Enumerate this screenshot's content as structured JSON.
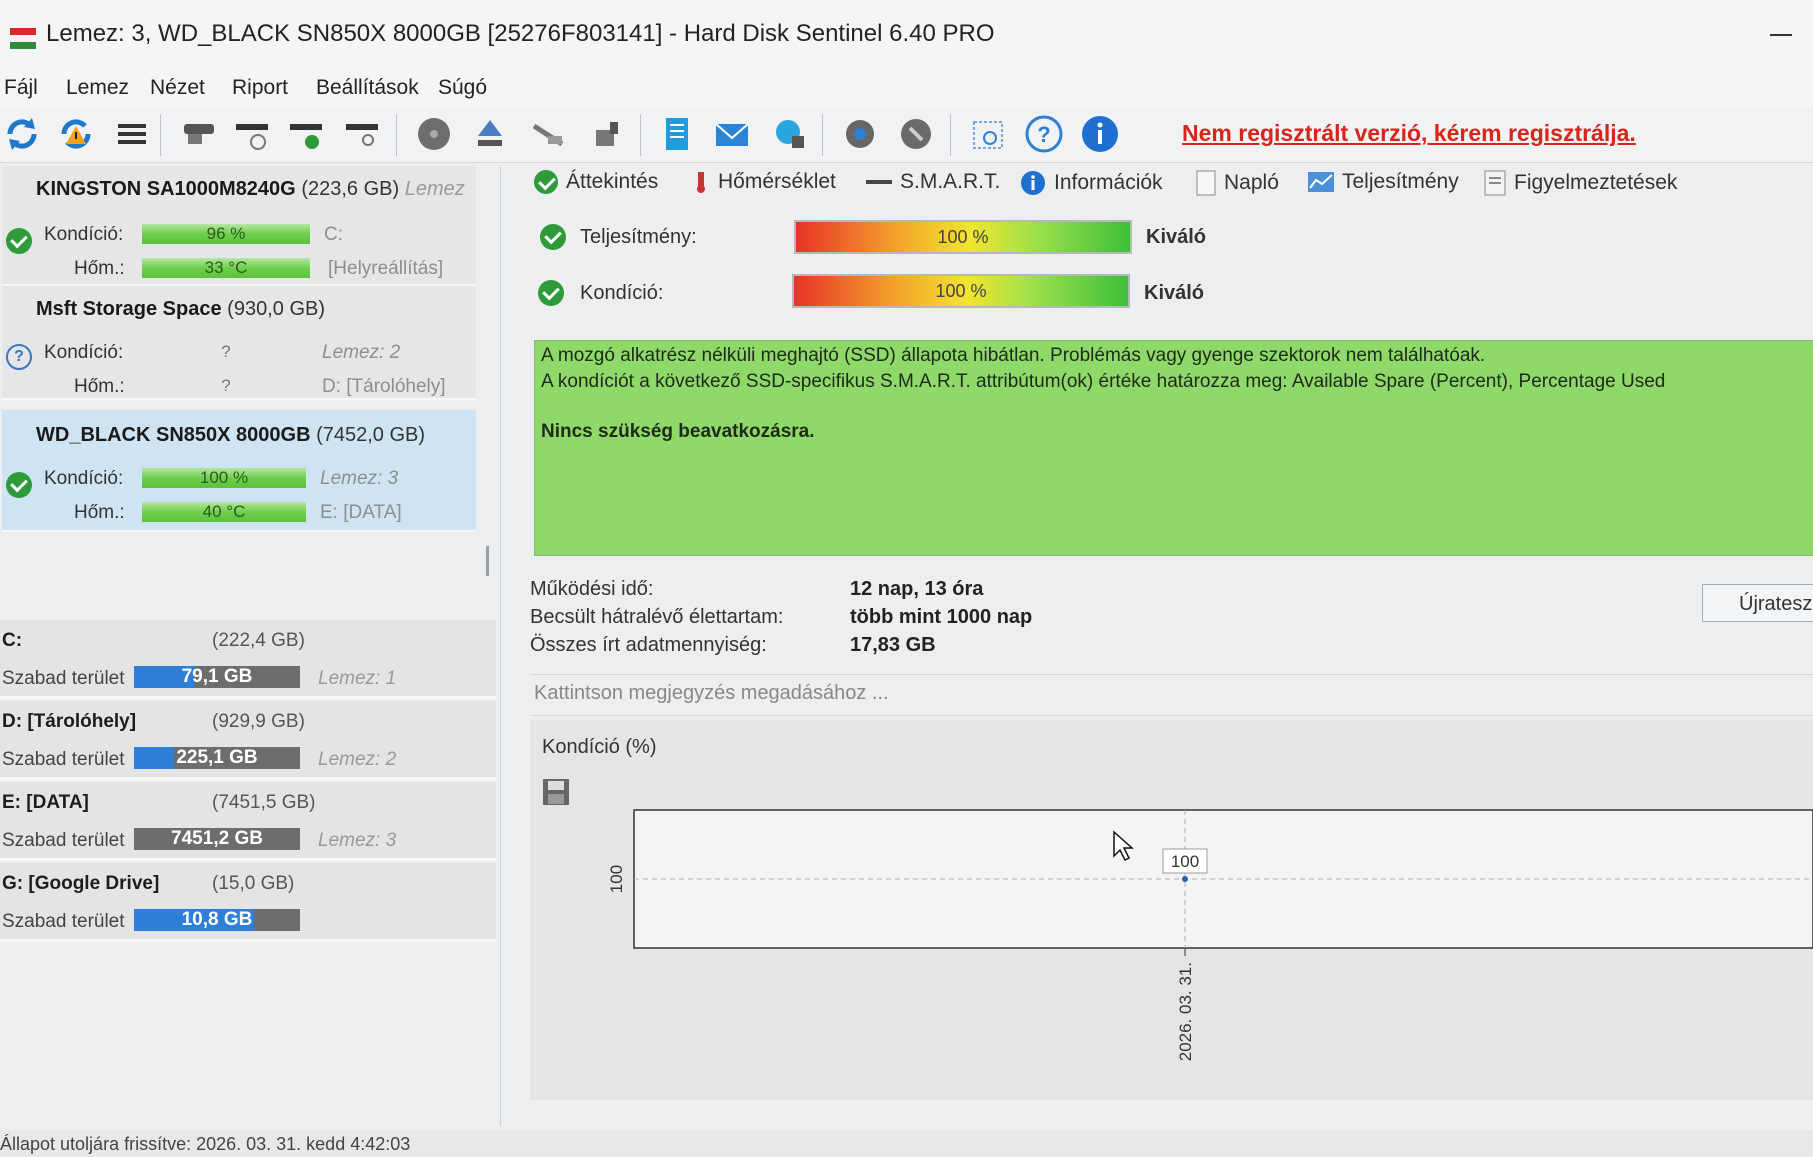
{
  "window": {
    "title": "Lemez: 3, WD_BLACK SN850X 8000GB [25276F803141]  -  Hard Disk Sentinel 6.40 PRO"
  },
  "menu": [
    "Fájl",
    "Lemez",
    "Nézet",
    "Riport",
    "Beállítások",
    "Súgó"
  ],
  "toolbar": {
    "icons": [
      "refresh-icon",
      "refresh-warning-icon",
      "disk-list-icon",
      "disk-icon",
      "disk-schedule-icon",
      "disk-check-icon",
      "disk-search-icon",
      "drive-icon",
      "eject-icon",
      "tools-icon",
      "gear-tools-icon",
      "report-icon",
      "email-icon",
      "network-icon",
      "settings-icon",
      "shield-icon",
      "screenshot-icon",
      "help-icon",
      "info-icon"
    ],
    "register_text": "Nem regisztrált verzió, kérem regisztrálja."
  },
  "disks": [
    {
      "name": "KINGSTON SA1000M8240G",
      "size": "(223,6 GB)",
      "lemez": "Lemez",
      "condition_label": "Kondíció:",
      "condition": "96 %",
      "condition_level": 0.96,
      "temp_label": "Hőm.:",
      "temp": "33 °C",
      "right1": "C:",
      "right2": "[Helyreállítás]",
      "status": "ok"
    },
    {
      "name": "Msft    Storage Space",
      "size": "(930,0 GB)",
      "lemez": "",
      "condition_label": "Kondíció:",
      "condition": "?",
      "temp_label": "Hőm.:",
      "temp": "?",
      "right1": "Lemez: 2",
      "right2": "D: [Tárolóhely]",
      "status": "unknown"
    },
    {
      "name": "WD_BLACK SN850X 8000GB",
      "size": "(7452,0 GB)",
      "lemez": "",
      "condition_label": "Kondíció:",
      "condition": "100 %",
      "condition_level": 1.0,
      "temp_label": "Hőm.:",
      "temp": "40 °C",
      "right1": "Lemez: 3",
      "right2": "E: [DATA]",
      "status": "ok"
    }
  ],
  "volumes": [
    {
      "name": "C:",
      "size": "(222,4 GB)",
      "free_label": "Szabad terület",
      "free": "79,1 GB",
      "free_fraction": 0.36,
      "lemez": "Lemez: 1"
    },
    {
      "name": "D: [Tárolóhely]",
      "size": "(929,9 GB)",
      "free_label": "Szabad terület",
      "free": "225,1 GB",
      "free_fraction": 0.24,
      "lemez": "Lemez: 2"
    },
    {
      "name": "E: [DATA]",
      "size": "(7451,5 GB)",
      "free_label": "Szabad terület",
      "free": "7451,2 GB",
      "free_fraction": 1.0,
      "lemez": "Lemez: 3"
    },
    {
      "name": "G: [Google Drive]",
      "size": "(15,0 GB)",
      "free_label": "Szabad terület",
      "free": "10,8 GB",
      "free_fraction": 0.72,
      "lemez": ""
    }
  ],
  "tabs": [
    "Áttekintés",
    "Hőmérséklet",
    "S.M.A.R.T.",
    "Információk",
    "Napló",
    "Teljesítmény",
    "Figyelmeztetések"
  ],
  "metrics": {
    "performance": {
      "label": "Teljesítmény:",
      "value": "100 %",
      "rating": "Kiváló"
    },
    "condition": {
      "label": "Kondíció:",
      "value": "100 %",
      "rating": "Kiváló"
    }
  },
  "summary": {
    "line1": "A mozgó alkatrész nélküli meghajtó (SSD) állapota hibátlan. Problémás vagy gyenge szektorok nem találhatóak.",
    "line2": "A kondíciót a következő SSD-specifikus S.M.A.R.T. attribútum(ok) értéke határozza meg:  Available Spare (Percent), Percentage Used",
    "line3": "Nincs szükség beavatkozásra."
  },
  "info": {
    "uptime_label": "Működési idő:",
    "uptime": "12 nap, 13 óra",
    "lifetime_label": "Becsült hátralévő élettartam:",
    "lifetime": "több mint 1000 nap",
    "written_label": "Összes írt adatmennyiség:",
    "written": "17,83 GB",
    "reset_button": "Újratesz"
  },
  "note_placeholder": "Kattintson megjegyzés megadásához ...",
  "chart_data": {
    "type": "line",
    "title": "Kondíció  (%)",
    "x": [
      "2026. 03. 31."
    ],
    "values": [
      100
    ],
    "point_label": "100",
    "ytick": "100",
    "xtick": "2026. 03. 31."
  },
  "status": {
    "text": "Állapot utoljára frissítve: 2026. 03. 31. kedd 4:42:03"
  }
}
